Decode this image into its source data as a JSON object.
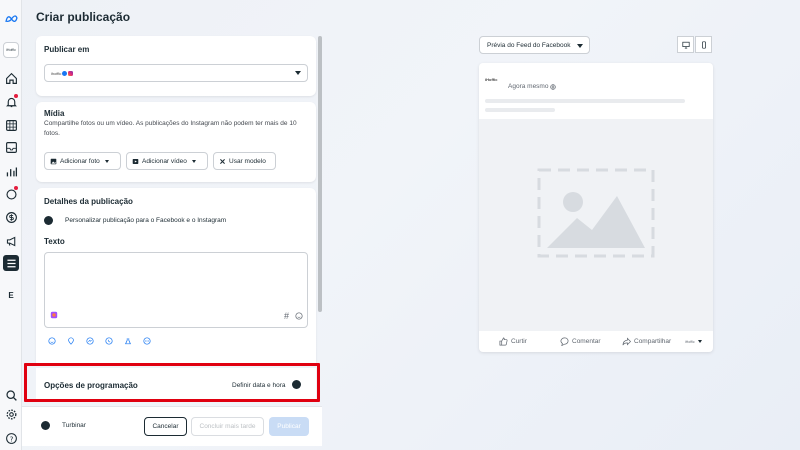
{
  "page": {
    "title": "Criar publicação"
  },
  "rail": {
    "avatar_text": "iHoffic",
    "letter_item": "E"
  },
  "publish_in": {
    "title": "Publicar em",
    "account_text": "ihoffic"
  },
  "media": {
    "title": "Mídia",
    "description": "Compartilhe fotos ou um vídeo. As publicações do Instagram não podem ter mais de 10 fotos.",
    "add_photo": "Adicionar foto",
    "add_video": "Adicionar vídeo",
    "use_template": "Usar modelo"
  },
  "details": {
    "title": "Detalhes da publicação",
    "customize_toggle": "Personalizar publicação para o Facebook e o Instagram",
    "text_label": "Texto",
    "hashtag": "#"
  },
  "schedule": {
    "title": "Opções de programação",
    "set_date_label": "Definir data e hora"
  },
  "footer": {
    "boost_label": "Turbinar",
    "cancel": "Cancelar",
    "finish_later": "Concluir mais tarde",
    "publish": "Publicar"
  },
  "preview": {
    "selector_label": "Prévia do Feed do Facebook",
    "account_name": "iHoffic",
    "time_label": "Agora mesmo",
    "like": "Curtir",
    "comment": "Comentar",
    "share": "Compartilhar"
  },
  "colors": {
    "highlight": "#e00010",
    "dark": "#1c2b33",
    "facebook": "#1877f2"
  }
}
